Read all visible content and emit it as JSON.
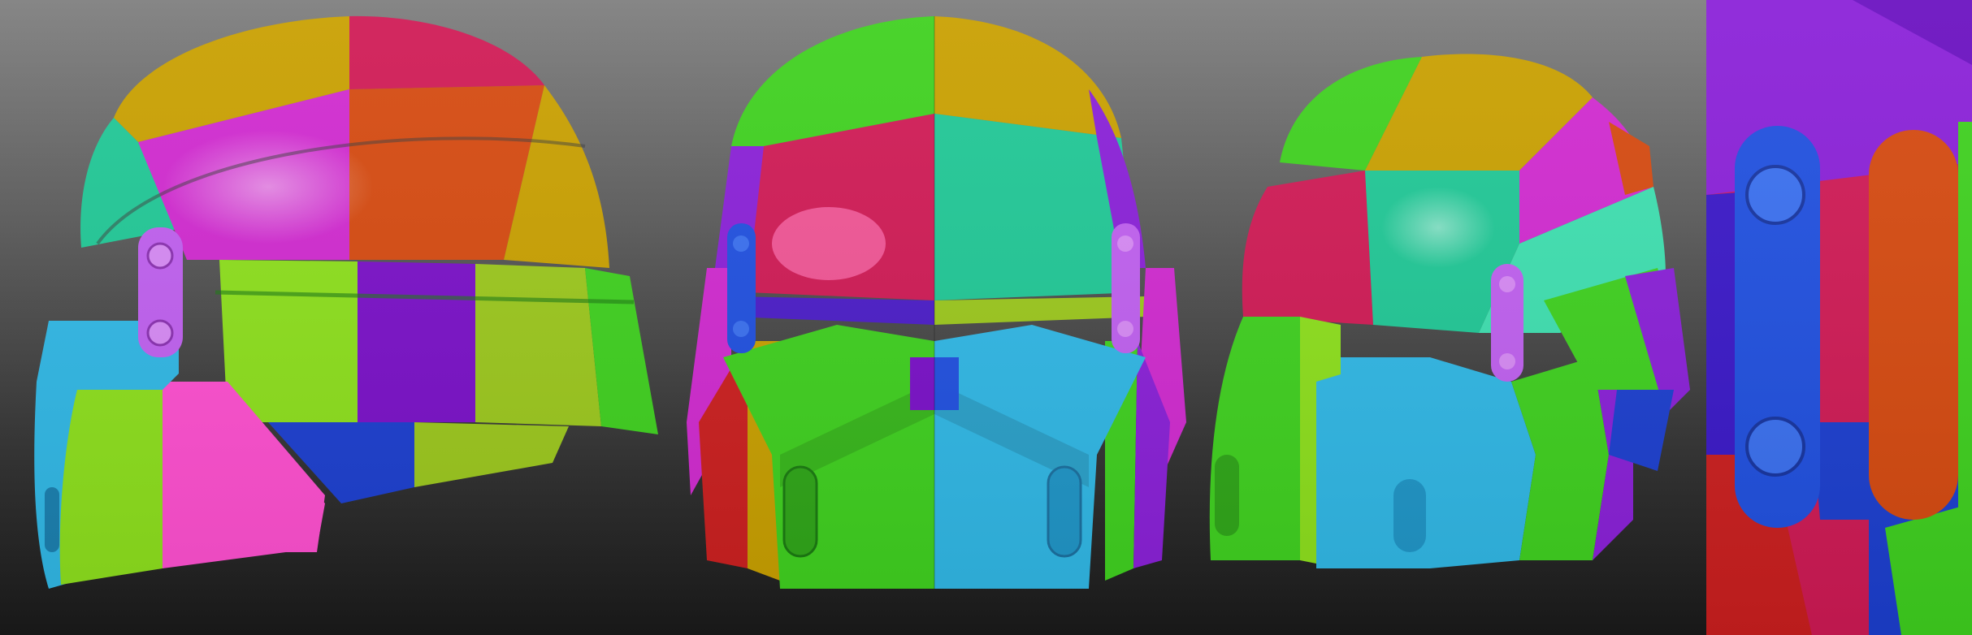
{
  "scene": {
    "description_free": true,
    "background": {
      "top": "#7e7e7e",
      "bottom": "#1a1a1a"
    },
    "palette": {
      "green": "#3fd11f",
      "lime": "#8de01c",
      "yellowgreen": "#9cc81d",
      "olive": "#c8b800",
      "gold": "#c9a000",
      "teal": "#20c896",
      "mint": "#3ee0b0",
      "crimson": "#d01a55",
      "magenta": "#d12ad0",
      "pink": "#ff4fd0",
      "orange": "#d64a10",
      "purple": "#7a10c8",
      "violet": "#8a20d8",
      "blue": "#1c3fd0",
      "royalblue": "#2050e0",
      "cyan": "#30b8e6",
      "red": "#cc1f1f",
      "lavender": "#c060f0",
      "darkgreen": "#1fa80e"
    },
    "views": [
      "helmet-side-view",
      "helmet-front-view",
      "helmet-three-quarter-view",
      "helmet-closeup-view"
    ]
  }
}
